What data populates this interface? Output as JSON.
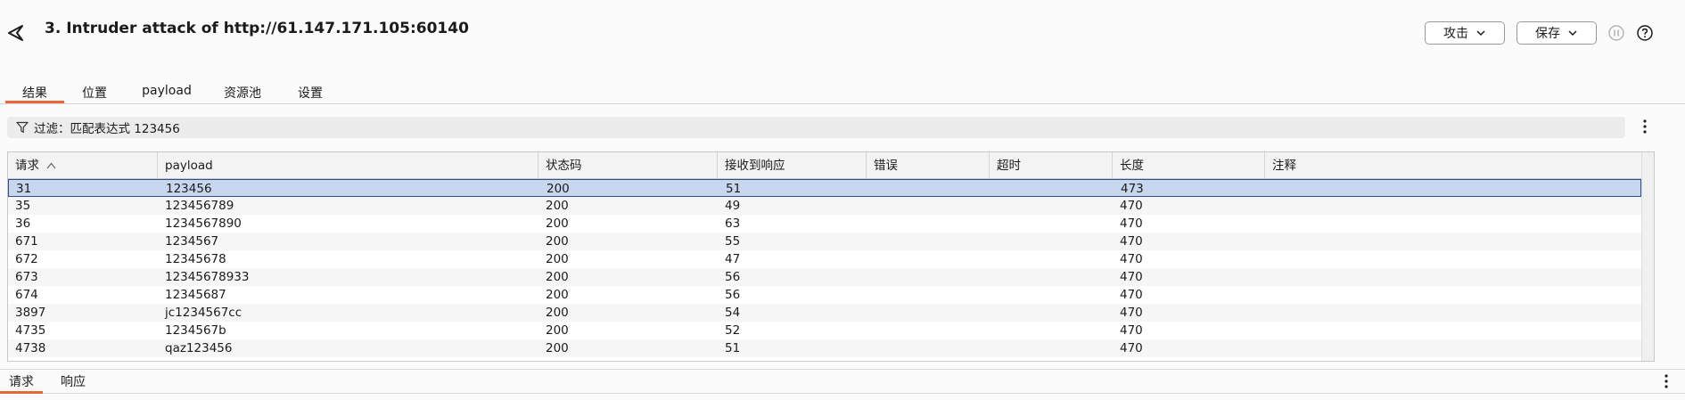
{
  "window": {
    "title": "3. Intruder attack of http://61.147.171.105:60140"
  },
  "toolbar": {
    "attack_label": "攻击",
    "save_label": "保存"
  },
  "tabs": [
    {
      "label": "结果",
      "active": true
    },
    {
      "label": "位置",
      "active": false
    },
    {
      "label": "payload",
      "active": false
    },
    {
      "label": "资源池",
      "active": false
    },
    {
      "label": "设置",
      "active": false
    }
  ],
  "filter": {
    "text": "过滤：匹配表达式 123456"
  },
  "table": {
    "columns": [
      "请求",
      "payload",
      "状态码",
      "接收到响应",
      "错误",
      "超时",
      "长度",
      "注释"
    ],
    "rows": [
      [
        "31",
        "123456",
        "200",
        "51",
        "",
        "",
        "473",
        ""
      ],
      [
        "35",
        "123456789",
        "200",
        "49",
        "",
        "",
        "470",
        ""
      ],
      [
        "36",
        "1234567890",
        "200",
        "63",
        "",
        "",
        "470",
        ""
      ],
      [
        "671",
        "1234567",
        "200",
        "55",
        "",
        "",
        "470",
        ""
      ],
      [
        "672",
        "12345678",
        "200",
        "47",
        "",
        "",
        "470",
        ""
      ],
      [
        "673",
        "12345678933",
        "200",
        "56",
        "",
        "",
        "470",
        ""
      ],
      [
        "674",
        "12345687",
        "200",
        "56",
        "",
        "",
        "470",
        ""
      ],
      [
        "3897",
        "jc1234567cc",
        "200",
        "54",
        "",
        "",
        "470",
        ""
      ],
      [
        "4735",
        "1234567b",
        "200",
        "52",
        "",
        "",
        "470",
        ""
      ],
      [
        "4738",
        "qaz123456",
        "200",
        "51",
        "",
        "",
        "470",
        ""
      ]
    ],
    "selected_row": 0
  },
  "bottom_tabs": [
    {
      "label": "请求",
      "active": true
    },
    {
      "label": "响应",
      "active": false
    }
  ],
  "icons": {
    "back": "back-triangle-icon",
    "chevron": "chevron-down-icon",
    "pause": "pause-icon",
    "help": "help-icon",
    "filter": "filter-icon",
    "sort": "sort-ascending-icon",
    "menu": "kebab-menu-icon"
  },
  "colors": {
    "accent": "#e8673a",
    "selection": "#c7d7f0",
    "selection_border": "#2e4f88"
  }
}
